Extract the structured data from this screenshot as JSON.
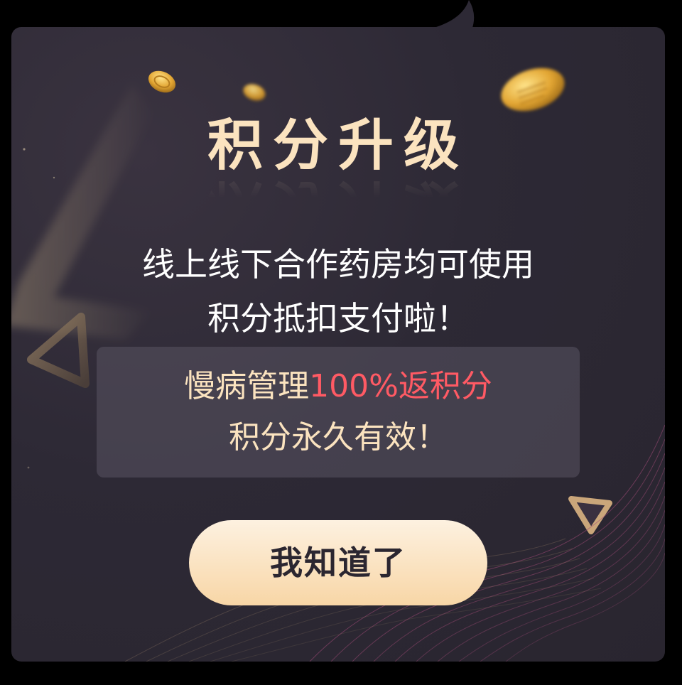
{
  "dialog": {
    "title": "积分升级",
    "subtitle_lines": [
      "线上线下合作药房均可使用",
      "积分抵扣支付啦！"
    ],
    "info": {
      "line1_prefix": "慢病管理",
      "line1_highlight": "100%返积分",
      "line2": "积分永久有效！"
    },
    "confirm_button": "我知道了"
  },
  "colors": {
    "card_background": "#2d2935",
    "title": "#fbe3bf",
    "highlight": "#ff5a64",
    "button_gradient_top": "#fdf1e0",
    "button_gradient_bottom": "#f8d6a6",
    "button_text": "#2b2630"
  },
  "decorations": [
    "gold-coin-icon",
    "triangle-icon",
    "wave-mesh"
  ]
}
